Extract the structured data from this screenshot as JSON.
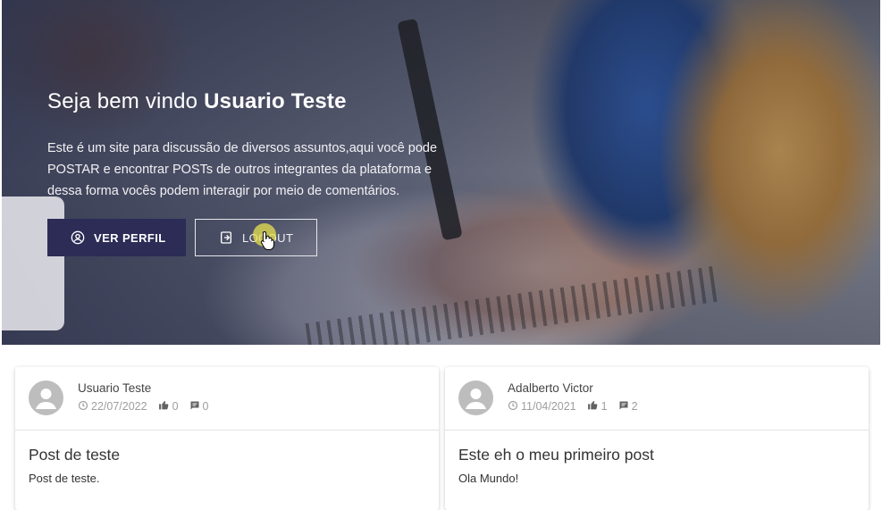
{
  "hero": {
    "welcome_prefix": "Seja bem vindo ",
    "user_name": "Usuario Teste",
    "description": "Este é um site para discussão de diversos assuntos,aqui você pode POSTAR e encontrar POSTs de outros integrantes da plataforma e dessa forma vocês podem interagir por meio de comentários.",
    "profile_button": "VER PERFIL",
    "logout_button": "LOGOUT"
  },
  "posts": [
    {
      "author": "Usuario Teste",
      "date": "22/07/2022",
      "likes": "0",
      "comments": "0",
      "title": "Post de teste",
      "text": "Post de teste."
    },
    {
      "author": "Adalberto Victor",
      "date": "11/04/2021",
      "likes": "1",
      "comments": "2",
      "title": "Este eh o meu primeiro post",
      "text": "Ola Mundo!"
    }
  ],
  "colors": {
    "primary_button": "#2c2c57",
    "meta_text": "#9e9e9e"
  },
  "icons": [
    "account-circle-icon",
    "logout-icon",
    "clock-icon",
    "thumb-up-icon",
    "comment-icon",
    "avatar-person-icon"
  ]
}
